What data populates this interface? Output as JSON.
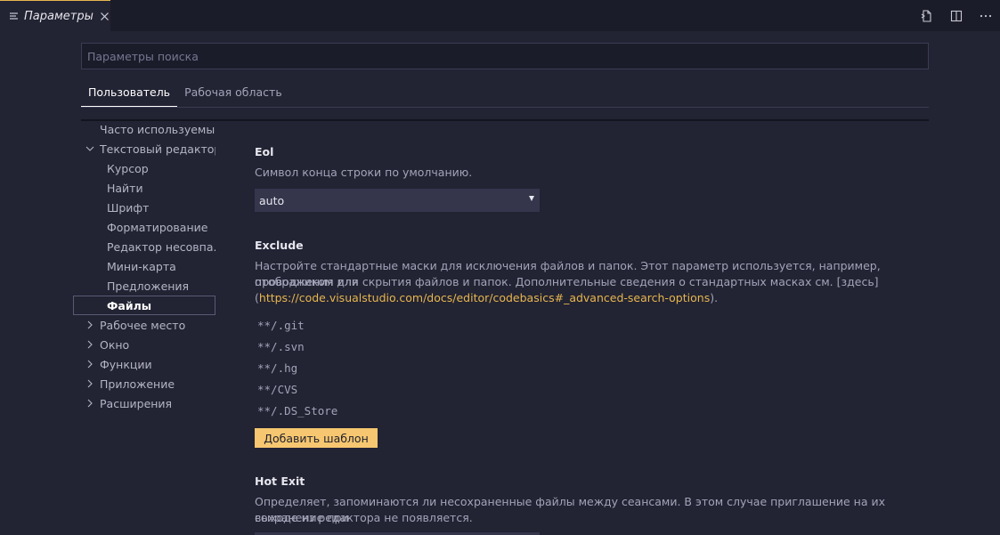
{
  "tab": {
    "title": "Параметры"
  },
  "search": {
    "placeholder": "Параметры поиска",
    "value": ""
  },
  "scope_tabs": [
    {
      "label": "Пользователь",
      "active": true
    },
    {
      "label": "Рабочая область",
      "active": false
    }
  ],
  "tree": [
    {
      "label": "Часто используемые",
      "level": 0,
      "chevron": "none"
    },
    {
      "label": "Текстовый редактор",
      "level": 0,
      "chevron": "down"
    },
    {
      "label": "Курсор",
      "level": 1
    },
    {
      "label": "Найти",
      "level": 1
    },
    {
      "label": "Шрифт",
      "level": 1
    },
    {
      "label": "Форматирование",
      "level": 1
    },
    {
      "label": "Редактор несовпа...",
      "level": 1
    },
    {
      "label": "Мини-карта",
      "level": 1
    },
    {
      "label": "Предложения",
      "level": 1
    },
    {
      "label": "Файлы",
      "level": 1,
      "selected": true
    },
    {
      "label": "Рабочее место",
      "level": 0,
      "chevron": "right"
    },
    {
      "label": "Окно",
      "level": 0,
      "chevron": "right"
    },
    {
      "label": "Функции",
      "level": 0,
      "chevron": "right"
    },
    {
      "label": "Приложение",
      "level": 0,
      "chevron": "right"
    },
    {
      "label": "Расширения",
      "level": 0,
      "chevron": "right"
    }
  ],
  "settings": {
    "eol": {
      "title": "Eol",
      "description": "Символ конца строки по умолчанию.",
      "value": "auto"
    },
    "exclude": {
      "title": "Exclude",
      "description_line1": "Настройте стандартные маски для исключения файлов и папок. Этот параметр используется, например, проводником для",
      "description_line2": "отображения или скрытия файлов и папок. Дополнительные сведения о стандартных масках см. [здесь]",
      "link_open": "(",
      "link": "https://code.visualstudio.com/docs/editor/codebasics#_advanced-search-options",
      "link_close": ").",
      "patterns": [
        "**/.git",
        "**/.svn",
        "**/.hg",
        "**/CVS",
        "**/.DS_Store"
      ],
      "add_button": "Добавить шаблон"
    },
    "hot_exit": {
      "title": "Hot Exit",
      "description_line1": "Определяет, запоминаются ли несохраненные файлы между сеансами. В этом случае приглашение на их сохранение при",
      "description_line2": "выходе из редактора не появляется."
    }
  },
  "colors": {
    "accent": "#e7b64e",
    "button": "#f6c770",
    "background": "#222333",
    "tabbar": "#1b1c29"
  }
}
